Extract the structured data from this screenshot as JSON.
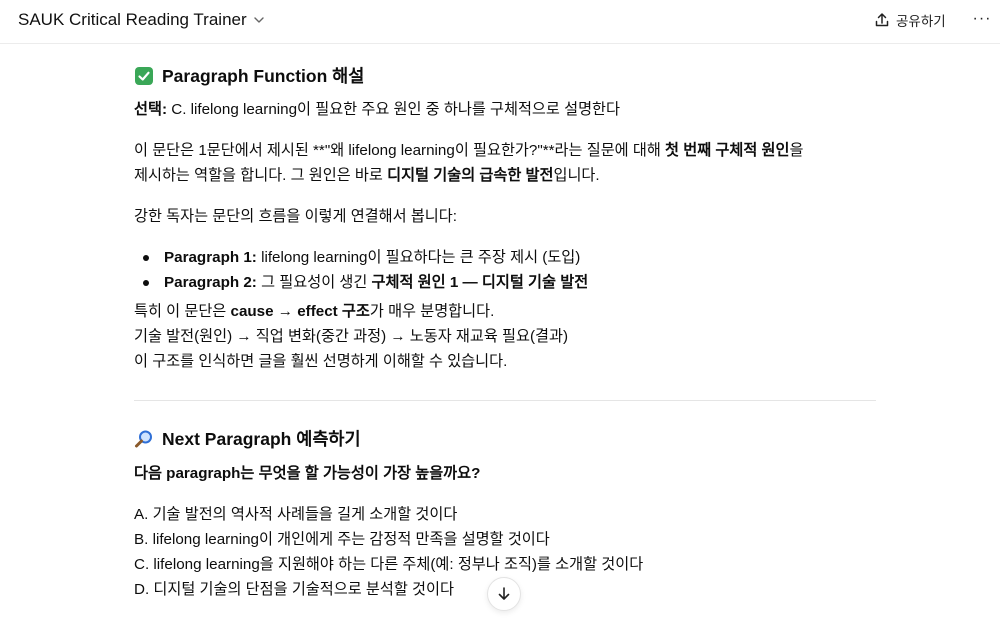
{
  "header": {
    "app_title": "SAUK Critical Reading Trainer",
    "share_label": "공유하기",
    "more_label": "···"
  },
  "section1": {
    "title": "Paragraph Function 해설",
    "selection_label": "선택:",
    "selection_text": " C. lifelong learning이 필요한 주요 원인 중 하나를 구체적으로 설명한다",
    "para1_a": "이 문단은 1문단에서 제시된 **\"왜 lifelong learning이 필요한가?\"**라는 질문에 대해 ",
    "para1_b": "첫 번째 구체적 원인",
    "para1_c": "을",
    "para1_d": "제시하는 역할을 합니다. 그 원인은 바로 ",
    "para1_e": "디지털 기술의 급속한 발전",
    "para1_f": "입니다.",
    "para2": "강한 독자는 문단의 흐름을 이렇게 연결해서 봅니다:",
    "bullets": [
      {
        "label": "Paragraph 1:",
        "text_a": " lifelong learning이 필요하다는 큰 주장 제시 (도입)",
        "text_b": ""
      },
      {
        "label": "Paragraph 2:",
        "text_a": " 그 필요성이 생긴 ",
        "text_b": "구체적 원인 1 — 디지털 기술 발전"
      }
    ],
    "para3_a": "특히 이 문단은 ",
    "para3_b": "cause → effect 구조",
    "para3_c": "가 매우 분명합니다.",
    "para3_line2": "기술 발전(원인) → 직업 변화(중간 과정) → 노동자 재교육 필요(결과)",
    "para3_line3": "이 구조를 인식하면 글을 훨씬 선명하게 이해할 수 있습니다."
  },
  "section2": {
    "title": "Next Paragraph 예측하기",
    "question": "다음 paragraph는 무엇을 할 가능성이 가장 높을까요?",
    "options": [
      "A. 기술 발전의 역사적 사례들을 길게 소개할 것이다",
      "B. lifelong learning이 개인에게 주는 감정적 만족을 설명할 것이다",
      "C. lifelong learning을 지원해야 하는 다른 주체(예: 정부나 조직)를 소개할 것이다",
      "D. 디지털 기술의 단점을 기술적으로 분석할 것이다"
    ]
  },
  "colors": {
    "check_green": "#3aa757",
    "magnifier_blue": "#2f6fd6"
  }
}
